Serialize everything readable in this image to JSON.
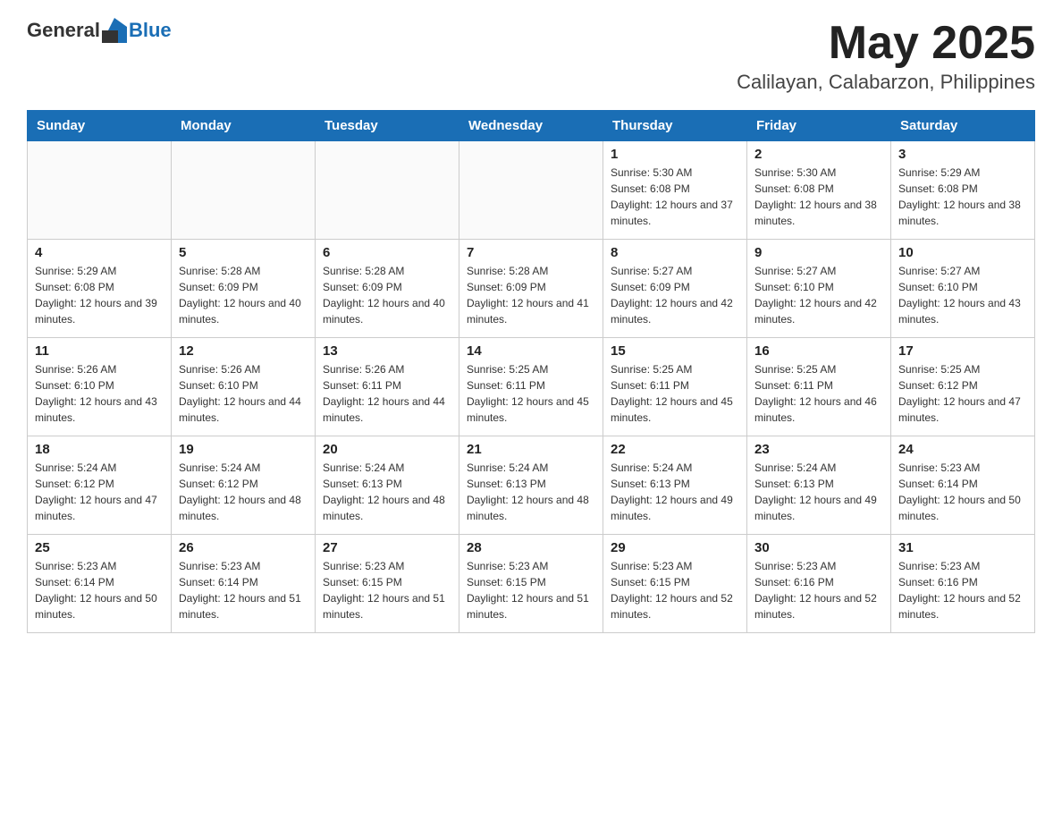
{
  "header": {
    "logo_general": "General",
    "logo_blue": "Blue",
    "month": "May 2025",
    "location": "Calilayan, Calabarzon, Philippines"
  },
  "weekdays": [
    "Sunday",
    "Monday",
    "Tuesday",
    "Wednesday",
    "Thursday",
    "Friday",
    "Saturday"
  ],
  "weeks": [
    [
      {
        "day": "",
        "info": ""
      },
      {
        "day": "",
        "info": ""
      },
      {
        "day": "",
        "info": ""
      },
      {
        "day": "",
        "info": ""
      },
      {
        "day": "1",
        "info": "Sunrise: 5:30 AM\nSunset: 6:08 PM\nDaylight: 12 hours and 37 minutes."
      },
      {
        "day": "2",
        "info": "Sunrise: 5:30 AM\nSunset: 6:08 PM\nDaylight: 12 hours and 38 minutes."
      },
      {
        "day": "3",
        "info": "Sunrise: 5:29 AM\nSunset: 6:08 PM\nDaylight: 12 hours and 38 minutes."
      }
    ],
    [
      {
        "day": "4",
        "info": "Sunrise: 5:29 AM\nSunset: 6:08 PM\nDaylight: 12 hours and 39 minutes."
      },
      {
        "day": "5",
        "info": "Sunrise: 5:28 AM\nSunset: 6:09 PM\nDaylight: 12 hours and 40 minutes."
      },
      {
        "day": "6",
        "info": "Sunrise: 5:28 AM\nSunset: 6:09 PM\nDaylight: 12 hours and 40 minutes."
      },
      {
        "day": "7",
        "info": "Sunrise: 5:28 AM\nSunset: 6:09 PM\nDaylight: 12 hours and 41 minutes."
      },
      {
        "day": "8",
        "info": "Sunrise: 5:27 AM\nSunset: 6:09 PM\nDaylight: 12 hours and 42 minutes."
      },
      {
        "day": "9",
        "info": "Sunrise: 5:27 AM\nSunset: 6:10 PM\nDaylight: 12 hours and 42 minutes."
      },
      {
        "day": "10",
        "info": "Sunrise: 5:27 AM\nSunset: 6:10 PM\nDaylight: 12 hours and 43 minutes."
      }
    ],
    [
      {
        "day": "11",
        "info": "Sunrise: 5:26 AM\nSunset: 6:10 PM\nDaylight: 12 hours and 43 minutes."
      },
      {
        "day": "12",
        "info": "Sunrise: 5:26 AM\nSunset: 6:10 PM\nDaylight: 12 hours and 44 minutes."
      },
      {
        "day": "13",
        "info": "Sunrise: 5:26 AM\nSunset: 6:11 PM\nDaylight: 12 hours and 44 minutes."
      },
      {
        "day": "14",
        "info": "Sunrise: 5:25 AM\nSunset: 6:11 PM\nDaylight: 12 hours and 45 minutes."
      },
      {
        "day": "15",
        "info": "Sunrise: 5:25 AM\nSunset: 6:11 PM\nDaylight: 12 hours and 45 minutes."
      },
      {
        "day": "16",
        "info": "Sunrise: 5:25 AM\nSunset: 6:11 PM\nDaylight: 12 hours and 46 minutes."
      },
      {
        "day": "17",
        "info": "Sunrise: 5:25 AM\nSunset: 6:12 PM\nDaylight: 12 hours and 47 minutes."
      }
    ],
    [
      {
        "day": "18",
        "info": "Sunrise: 5:24 AM\nSunset: 6:12 PM\nDaylight: 12 hours and 47 minutes."
      },
      {
        "day": "19",
        "info": "Sunrise: 5:24 AM\nSunset: 6:12 PM\nDaylight: 12 hours and 48 minutes."
      },
      {
        "day": "20",
        "info": "Sunrise: 5:24 AM\nSunset: 6:13 PM\nDaylight: 12 hours and 48 minutes."
      },
      {
        "day": "21",
        "info": "Sunrise: 5:24 AM\nSunset: 6:13 PM\nDaylight: 12 hours and 48 minutes."
      },
      {
        "day": "22",
        "info": "Sunrise: 5:24 AM\nSunset: 6:13 PM\nDaylight: 12 hours and 49 minutes."
      },
      {
        "day": "23",
        "info": "Sunrise: 5:24 AM\nSunset: 6:13 PM\nDaylight: 12 hours and 49 minutes."
      },
      {
        "day": "24",
        "info": "Sunrise: 5:23 AM\nSunset: 6:14 PM\nDaylight: 12 hours and 50 minutes."
      }
    ],
    [
      {
        "day": "25",
        "info": "Sunrise: 5:23 AM\nSunset: 6:14 PM\nDaylight: 12 hours and 50 minutes."
      },
      {
        "day": "26",
        "info": "Sunrise: 5:23 AM\nSunset: 6:14 PM\nDaylight: 12 hours and 51 minutes."
      },
      {
        "day": "27",
        "info": "Sunrise: 5:23 AM\nSunset: 6:15 PM\nDaylight: 12 hours and 51 minutes."
      },
      {
        "day": "28",
        "info": "Sunrise: 5:23 AM\nSunset: 6:15 PM\nDaylight: 12 hours and 51 minutes."
      },
      {
        "day": "29",
        "info": "Sunrise: 5:23 AM\nSunset: 6:15 PM\nDaylight: 12 hours and 52 minutes."
      },
      {
        "day": "30",
        "info": "Sunrise: 5:23 AM\nSunset: 6:16 PM\nDaylight: 12 hours and 52 minutes."
      },
      {
        "day": "31",
        "info": "Sunrise: 5:23 AM\nSunset: 6:16 PM\nDaylight: 12 hours and 52 minutes."
      }
    ]
  ]
}
